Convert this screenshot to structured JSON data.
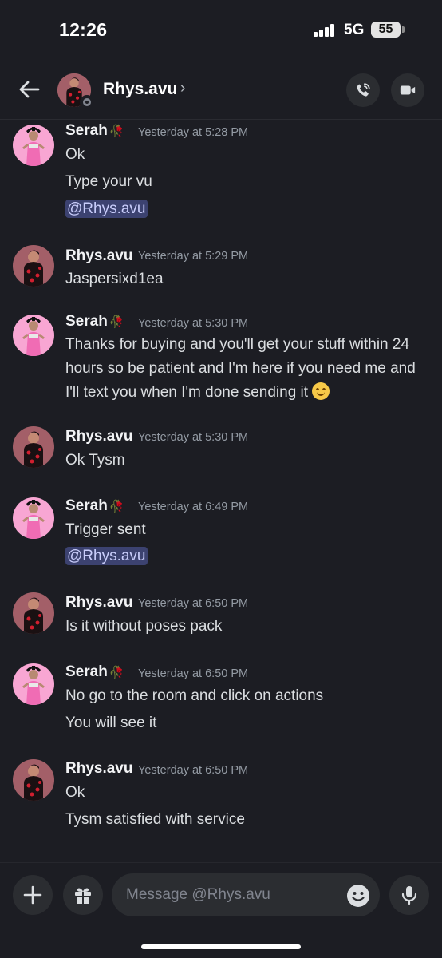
{
  "status_bar": {
    "time": "12:26",
    "network": "5G",
    "battery": "55"
  },
  "header": {
    "name": "Rhys.avu",
    "chevron": "›",
    "status": "idle"
  },
  "input": {
    "placeholder": "Message @Rhys.avu"
  },
  "colors": {
    "background": "#1c1d23",
    "mention_bg": "#3c4270",
    "mention_text": "#c9cdfb",
    "timestamp": "#949ba4",
    "accent": "#5865f2"
  },
  "icons": [
    "back-arrow-icon",
    "phone-call-icon",
    "video-camera-icon",
    "plus-icon",
    "gift-icon",
    "emoji-icon",
    "microphone-icon",
    "rose-emoji-icon",
    "smiling-face-emoji-icon"
  ],
  "messages": [
    {
      "author": "Serah",
      "avatar": "serah",
      "time": "Yesterday at 5:28 PM",
      "lines": [
        "Ok",
        "Type your vu"
      ],
      "mention": "@Rhys.avu"
    },
    {
      "author": "Rhys.avu",
      "avatar": "rhys",
      "time": "Yesterday at 5:29 PM",
      "lines": [
        "Jaspersixd1ea"
      ]
    },
    {
      "author": "Serah",
      "avatar": "serah",
      "time": "Yesterday at 5:30 PM",
      "lines": [
        "Thanks for buying and you'll get your stuff within 24",
        "hours so be patient and I'm here if you need me and",
        "I'll text you when I'm done sending it"
      ]
    },
    {
      "author": "Rhys.avu",
      "avatar": "rhys",
      "time": "Yesterday at 5:30 PM",
      "lines": [
        "Ok Tysm"
      ]
    },
    {
      "author": "Serah",
      "avatar": "serah",
      "time": "Yesterday at 6:49 PM",
      "lines": [
        "Trigger sent"
      ],
      "mention": "@Rhys.avu"
    },
    {
      "author": "Rhys.avu",
      "avatar": "rhys",
      "time": "Yesterday at 6:50 PM",
      "lines": [
        "Is it without poses pack"
      ]
    },
    {
      "author": "Serah",
      "avatar": "serah",
      "time": "Yesterday at 6:50 PM",
      "lines": [
        "No go to the room and click on actions",
        "You will see it"
      ]
    },
    {
      "author": "Rhys.avu",
      "avatar": "rhys",
      "time": "Yesterday at 6:50 PM",
      "lines": [
        "Ok",
        "Tysm satisfied with service"
      ]
    }
  ]
}
